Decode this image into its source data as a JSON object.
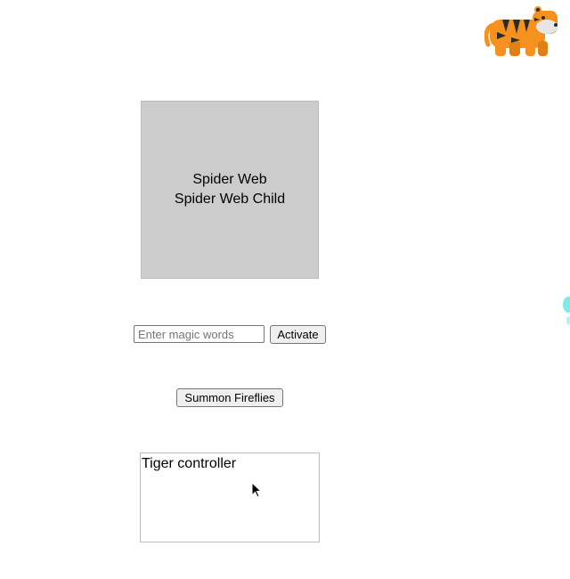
{
  "spider_web": {
    "label": "Spider Web",
    "child_label": "Spider Web Child"
  },
  "magic": {
    "placeholder": "Enter magic words",
    "value": "",
    "activate_label": "Activate"
  },
  "fireflies": {
    "button_label": "Summon Fireflies"
  },
  "tiger_controller": {
    "label": "Tiger controller"
  },
  "icons": {
    "mascot": "tiger-icon",
    "cursor": "mouse-pointer-icon"
  },
  "colors": {
    "spider_web_bg": "#cccccc",
    "tiger_orange": "#f5911e",
    "firefly": "#5ee6e6"
  }
}
